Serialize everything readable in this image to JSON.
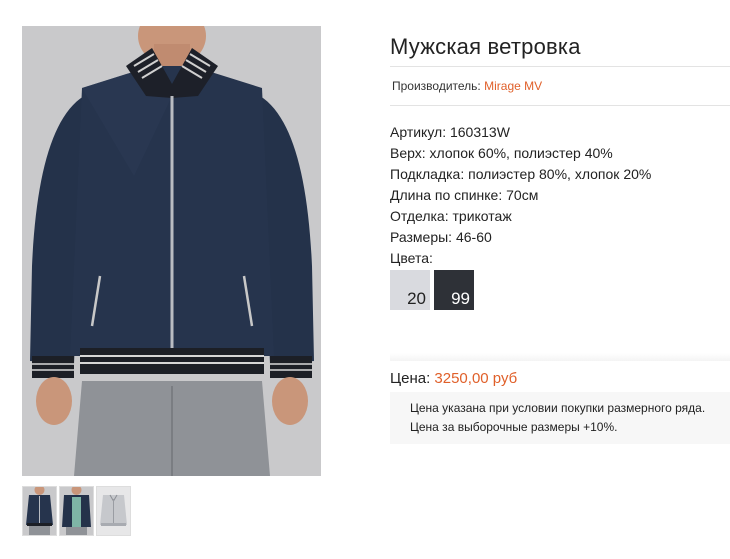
{
  "product": {
    "title": "Мужская ветровка",
    "maker_label": "Производитель:",
    "maker_name": "Mirage MV",
    "specs": [
      "Артикул: 160313W",
      "Верх: хлопок 60%, полиэстер 40%",
      "Подкладка: полиэстер 80%, хлопок 20%",
      "Длина по спинке: 70см",
      "Отделка: трикотаж",
      "Размеры: 46-60",
      "Цвета:"
    ],
    "colors": [
      {
        "code": "20",
        "hex": "#d9dadf"
      },
      {
        "code": "99",
        "hex": "#2e3137"
      }
    ],
    "price_label": "Цена:",
    "price_value": "3250,00 руб",
    "notes": [
      "Цена указана при условии покупки размерного ряда.",
      "Цена за выборочные размеры +10%."
    ]
  },
  "gallery": {
    "thumbnails": [
      "navy-jacket-front",
      "navy-jacket-open",
      "grey-jacket"
    ]
  },
  "colors": {
    "accent": "#e0602a",
    "jacket_navy": "#24324a",
    "background": "#c9c9cb"
  }
}
